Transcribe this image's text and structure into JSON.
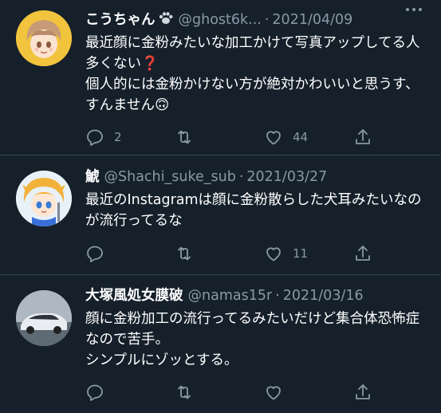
{
  "tweets": [
    {
      "name": "こうちゃん",
      "handle": "@ghost6k...",
      "date": "2021/04/09",
      "text": "最近顔に金粉みたいな加工かけて写真アップしてる人多くない❓\n個人的には金粉かけない方が絶対かわいいと思うす、すんません🙃",
      "replies": "2",
      "retweets": "",
      "likes": "44"
    },
    {
      "name": "鯱",
      "handle": "@Shachi_suke_sub",
      "date": "2021/03/27",
      "text": "最近のInstagramは顔に金粉散らした犬耳みたいなのが流行ってるな",
      "replies": "",
      "retweets": "",
      "likes": "11"
    },
    {
      "name": "大塚風処女膜破",
      "handle": "@namas15r",
      "date": "2021/03/16",
      "text": "顔に金粉加工の流行ってるみたいだけど集合体恐怖症なので苦手。\nシンプルにゾッとする。",
      "replies": "",
      "retweets": "",
      "likes": ""
    }
  ],
  "separator": "·",
  "icons": {
    "reply": "reply-icon",
    "retweet": "retweet-icon",
    "like": "heart-icon",
    "share": "share-icon",
    "more": "more-icon"
  },
  "colors": {
    "background": "#15202b",
    "text": "#ffffff",
    "secondary": "#8b98a5",
    "divider": "#38444d"
  }
}
